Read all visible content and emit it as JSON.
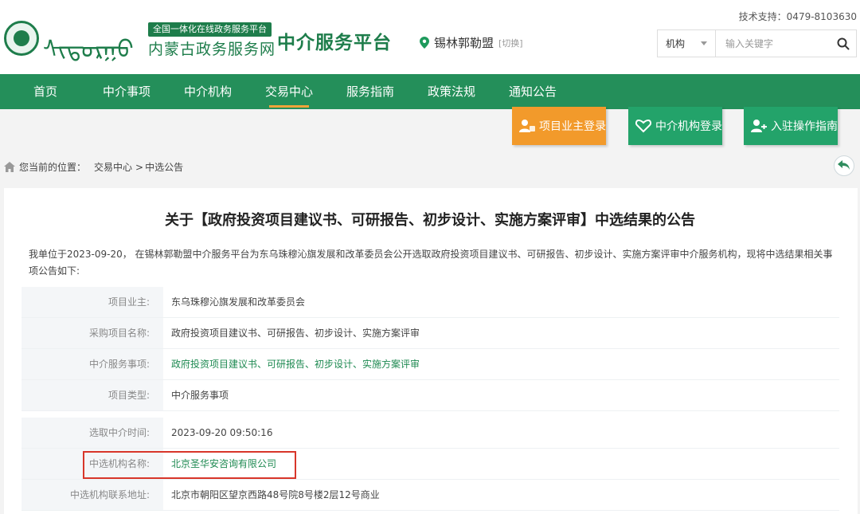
{
  "header": {
    "logo_mongolian": "ᠰᠢᠳᠤᠷᠭᠤ",
    "logo_tag": "全国一体化在线政务服务平台",
    "site_name": "内蒙古政务服务网",
    "platform_name": "中介服务平台",
    "location": "锡林郭勒盟",
    "switch_label": "[切换]",
    "support": "技术支持：0479-8103630"
  },
  "search": {
    "category": "机构",
    "placeholder": "输入关键字"
  },
  "nav": {
    "items": [
      "首页",
      "中介事项",
      "中介机构",
      "交易中心",
      "服务指南",
      "政策法规",
      "通知公告"
    ],
    "active_index": 3
  },
  "login_buttons": {
    "owner": "项目业主登录",
    "agency": "中介机构登录",
    "guide": "入驻操作指南"
  },
  "breadcrumb": {
    "label": "您当前的位置：",
    "level1": "交易中心",
    "sep": ">",
    "level2": "中选公告"
  },
  "notice": {
    "title": "关于【政府投资项目建议书、可研报告、初步设计、实施方案评审】中选结果的公告",
    "intro": "我单位于2023-09-20， 在锡林郭勒盟中介服务平台为东乌珠穆沁旗发展和改革委员会公开选取政府投资项目建议书、可研报告、初步设计、实施方案评审中介服务机构，现将中选结果相关事项公告如下:",
    "rows": [
      {
        "label": "项目业主:",
        "value": "东乌珠穆沁旗发展和改革委员会"
      },
      {
        "label": "采购项目名称:",
        "value": "政府投资项目建议书、可研报告、初步设计、实施方案评审"
      },
      {
        "label": "中介服务事项:",
        "value": "政府投资项目建议书、可研报告、初步设计、实施方案评审"
      },
      {
        "label": "项目类型:",
        "value": "中介服务事项"
      },
      {
        "label": "选取中介时间:",
        "value": "2023-09-20 09:50:16"
      },
      {
        "label": "中选机构名称:",
        "value": "北京圣华安咨询有限公司"
      },
      {
        "label": "中选机构联系地址:",
        "value": "北京市朝阳区望京西路48号院8号楼2层12号商业"
      }
    ]
  },
  "colors": {
    "primary_green": "#248f5a",
    "accent_orange": "#f29a2b",
    "highlight_red": "#d8362a"
  }
}
